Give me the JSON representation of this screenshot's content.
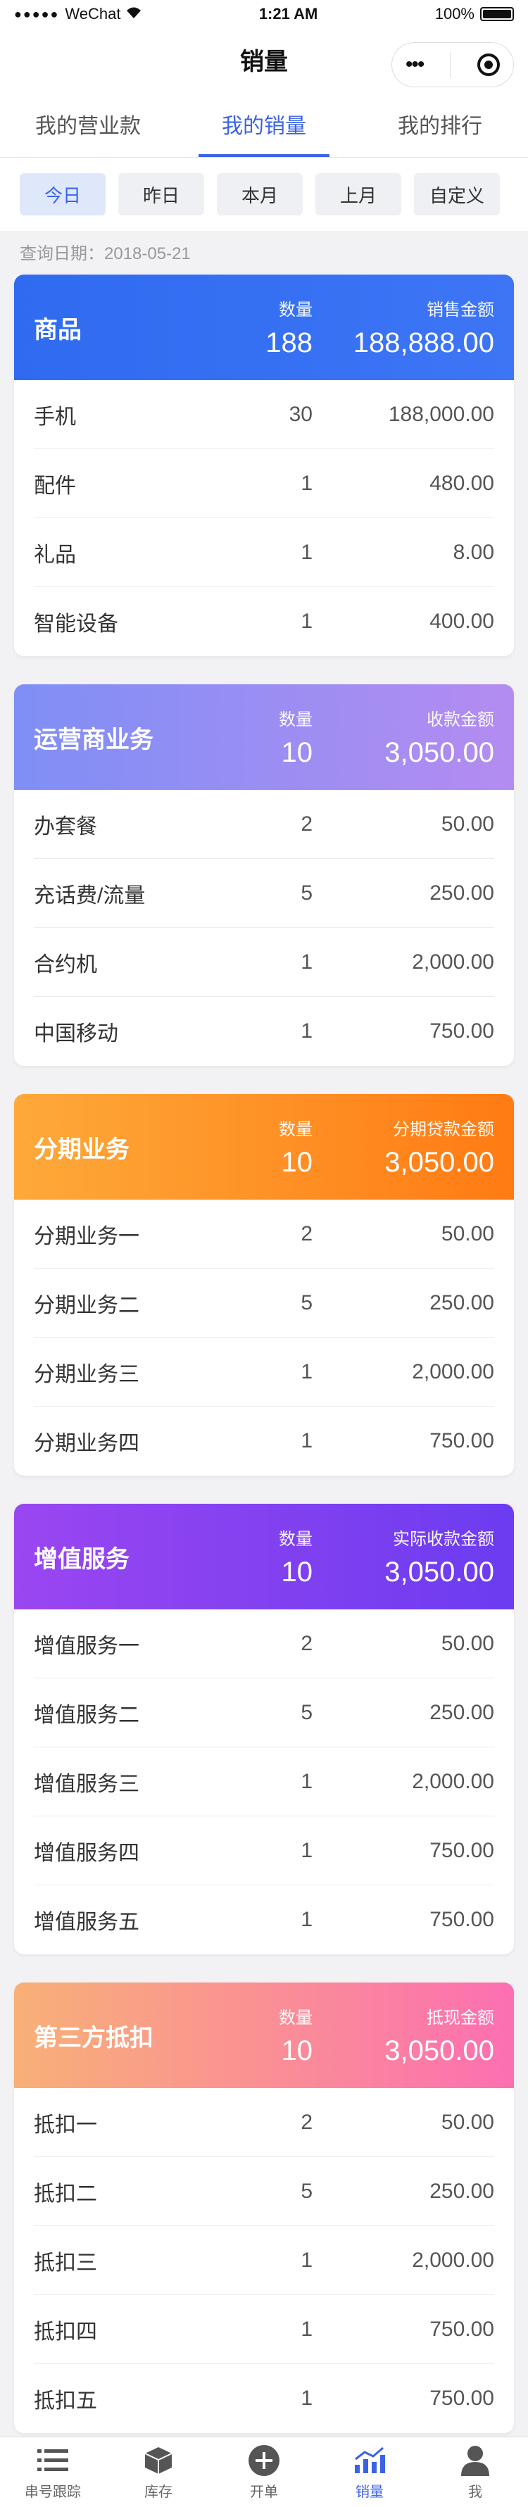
{
  "status": {
    "carrier": "WeChat",
    "time": "1:21 AM",
    "battery": "100%"
  },
  "navbar": {
    "title": "销量",
    "more": "•••"
  },
  "tabs": [
    {
      "label": "我的营业款",
      "active": false
    },
    {
      "label": "我的销量",
      "active": true
    },
    {
      "label": "我的排行",
      "active": false
    }
  ],
  "filters": [
    {
      "label": "今日",
      "active": true
    },
    {
      "label": "昨日",
      "active": false
    },
    {
      "label": "本月",
      "active": false
    },
    {
      "label": "上月",
      "active": false
    },
    {
      "label": "自定义",
      "active": false
    }
  ],
  "query": {
    "label": "查询日期：",
    "date": "2018-05-21"
  },
  "cards": [
    {
      "name": "商品",
      "qty_label": "数量",
      "qty": "188",
      "amt_label": "销售金额",
      "amt": "188,888.00",
      "color": "blue",
      "rows": [
        {
          "name": "手机",
          "qty": "30",
          "amt": "188,000.00"
        },
        {
          "name": "配件",
          "qty": "1",
          "amt": "480.00"
        },
        {
          "name": "礼品",
          "qty": "1",
          "amt": "8.00"
        },
        {
          "name": "智能设备",
          "qty": "1",
          "amt": "400.00"
        }
      ]
    },
    {
      "name": "运营商业务",
      "qty_label": "数量",
      "qty": "10",
      "amt_label": "收款金额",
      "amt": "3,050.00",
      "color": "purple",
      "rows": [
        {
          "name": "办套餐",
          "qty": "2",
          "amt": "50.00"
        },
        {
          "name": "充话费/流量",
          "qty": "5",
          "amt": "250.00"
        },
        {
          "name": "合约机",
          "qty": "1",
          "amt": "2,000.00"
        },
        {
          "name": "中国移动",
          "qty": "1",
          "amt": "750.00"
        }
      ]
    },
    {
      "name": "分期业务",
      "qty_label": "数量",
      "qty": "10",
      "amt_label": "分期贷款金额",
      "amt": "3,050.00",
      "color": "orange",
      "rows": [
        {
          "name": "分期业务一",
          "qty": "2",
          "amt": "50.00"
        },
        {
          "name": "分期业务二",
          "qty": "5",
          "amt": "250.00"
        },
        {
          "name": "分期业务三",
          "qty": "1",
          "amt": "2,000.00"
        },
        {
          "name": "分期业务四",
          "qty": "1",
          "amt": "750.00"
        }
      ]
    },
    {
      "name": "增值服务",
      "qty_label": "数量",
      "qty": "10",
      "amt_label": "实际收款金额",
      "amt": "3,050.00",
      "color": "violet",
      "rows": [
        {
          "name": "增值服务一",
          "qty": "2",
          "amt": "50.00"
        },
        {
          "name": "增值服务二",
          "qty": "5",
          "amt": "250.00"
        },
        {
          "name": "增值服务三",
          "qty": "1",
          "amt": "2,000.00"
        },
        {
          "name": "增值服务四",
          "qty": "1",
          "amt": "750.00"
        },
        {
          "name": "增值服务五",
          "qty": "1",
          "amt": "750.00"
        }
      ]
    },
    {
      "name": "第三方抵扣",
      "qty_label": "数量",
      "qty": "10",
      "amt_label": "抵现金额",
      "amt": "3,050.00",
      "color": "pink",
      "rows": [
        {
          "name": "抵扣一",
          "qty": "2",
          "amt": "50.00"
        },
        {
          "name": "抵扣二",
          "qty": "5",
          "amt": "250.00"
        },
        {
          "name": "抵扣三",
          "qty": "1",
          "amt": "2,000.00"
        },
        {
          "name": "抵扣四",
          "qty": "1",
          "amt": "750.00"
        },
        {
          "name": "抵扣五",
          "qty": "1",
          "amt": "750.00"
        }
      ]
    }
  ],
  "tabbar": [
    {
      "label": "串号跟踪",
      "icon": "list-icon",
      "active": false
    },
    {
      "label": "库存",
      "icon": "box-icon",
      "active": false
    },
    {
      "label": "开单",
      "icon": "plus-circle-icon",
      "active": false
    },
    {
      "label": "销量",
      "icon": "chart-icon",
      "active": true
    },
    {
      "label": "我",
      "icon": "user-icon",
      "active": false
    }
  ],
  "colors": {
    "accent": "#3b63e6"
  }
}
